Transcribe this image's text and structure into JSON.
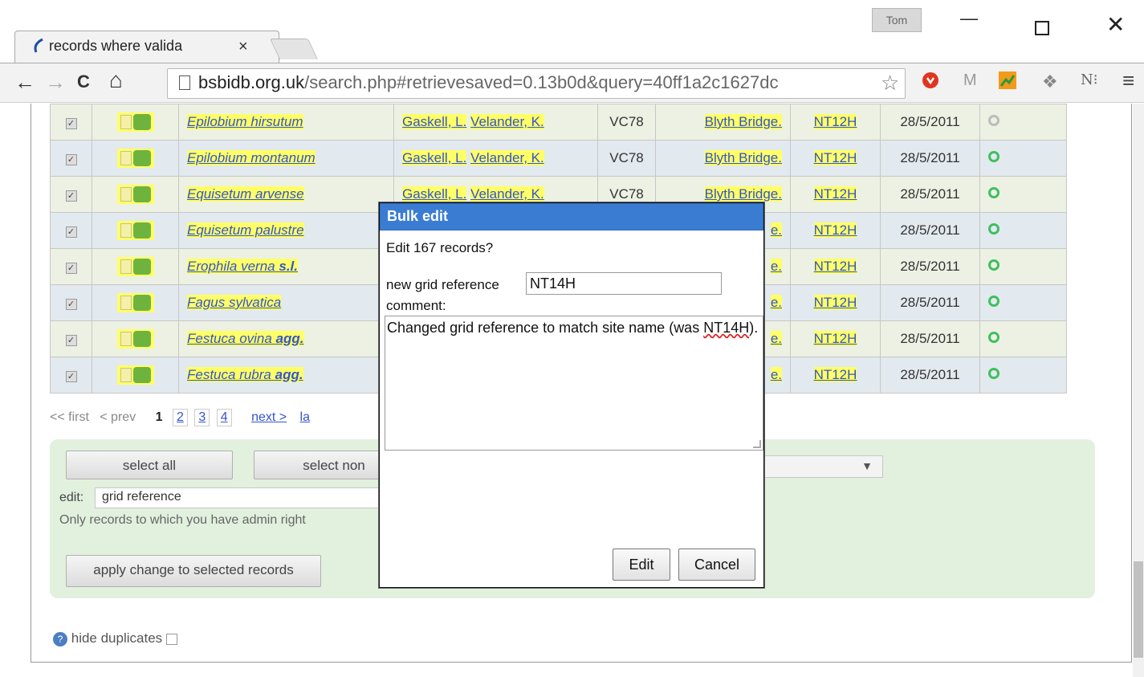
{
  "browser": {
    "tab_title": "records where valida",
    "tab_close": "×",
    "profile_name": "Tom",
    "url_domain": "bsbidb.org.uk",
    "url_path": "/search.php#retrievesaved=0.13b0d&query=40ff1a2c1627dc",
    "back_glyph": "←",
    "forward_glyph": "→",
    "reload_glyph": "C",
    "home_glyph": "⌂",
    "star_glyph": "☆",
    "menu_glyph": "≡"
  },
  "records": [
    {
      "taxon": "Epilobium hirsutum",
      "taxon_suffix": "",
      "recorder1": "Gaskell, L.",
      "recorder2": "Velander, K.",
      "vc": "VC78",
      "site": "Blyth Bridge.",
      "grid": "NT12H",
      "date": "28/5/2011",
      "status": "grey"
    },
    {
      "taxon": "Epilobium montanum",
      "taxon_suffix": "",
      "recorder1": "Gaskell, L.",
      "recorder2": "Velander, K.",
      "vc": "VC78",
      "site": "Blyth Bridge.",
      "grid": "NT12H",
      "date": "28/5/2011",
      "status": "green"
    },
    {
      "taxon": "Equisetum arvense",
      "taxon_suffix": "",
      "recorder1": "Gaskell, L.",
      "recorder2": "Velander, K.",
      "vc": "VC78",
      "site": "Blyth Bridge.",
      "grid": "NT12H",
      "date": "28/5/2011",
      "status": "green"
    },
    {
      "taxon": "Equisetum palustre",
      "taxon_suffix": "",
      "recorder1": "",
      "recorder2": "",
      "vc": "",
      "site": "e.",
      "grid": "NT12H",
      "date": "28/5/2011",
      "status": "green"
    },
    {
      "taxon": "Erophila verna",
      "taxon_suffix": "s.l.",
      "recorder1": "",
      "recorder2": "",
      "vc": "",
      "site": "e.",
      "grid": "NT12H",
      "date": "28/5/2011",
      "status": "green"
    },
    {
      "taxon": "Fagus sylvatica",
      "taxon_suffix": "",
      "recorder1": "",
      "recorder2": "",
      "vc": "",
      "site": "e.",
      "grid": "NT12H",
      "date": "28/5/2011",
      "status": "green"
    },
    {
      "taxon": "Festuca ovina",
      "taxon_suffix": "agg.",
      "recorder1": "",
      "recorder2": "",
      "vc": "",
      "site": "e.",
      "grid": "NT12H",
      "date": "28/5/2011",
      "status": "green"
    },
    {
      "taxon": "Festuca rubra",
      "taxon_suffix": "agg.",
      "recorder1": "",
      "recorder2": "",
      "vc": "",
      "site": "e.",
      "grid": "NT12H",
      "date": "28/5/2011",
      "status": "green"
    }
  ],
  "pager": {
    "first": "<< first",
    "prev": "< prev",
    "current": "1",
    "pages": [
      "2",
      "3",
      "4"
    ],
    "next": "next >",
    "last": "la"
  },
  "actions": {
    "select_all": "select all",
    "select_none": "select non",
    "edit_label": "edit:",
    "edit_value": "grid reference",
    "right_select_arrow": "▼",
    "admin_note": "Only records to which you have admin right",
    "apply": "apply change to selected records",
    "hide_duplicates": "hide duplicates",
    "help_glyph": "?"
  },
  "dialog": {
    "title": "Bulk edit",
    "question": "Edit 167 records?",
    "grid_label": "new grid reference",
    "grid_value": "NT14H",
    "comment_label": "comment:",
    "comment_text_1": "Changed grid reference to match site name (was ",
    "comment_text_2": "NT14H",
    "comment_text_3": ").",
    "edit_button": "Edit",
    "cancel_button": "Cancel"
  }
}
